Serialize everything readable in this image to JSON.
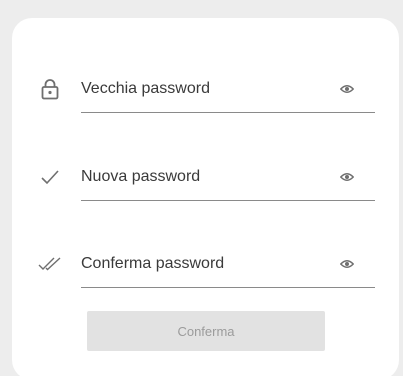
{
  "form": {
    "fields": [
      {
        "label": "Vecchia password",
        "leading_icon": "lock-icon",
        "trailing_icon": "eye-icon"
      },
      {
        "label": "Nuova password",
        "leading_icon": "check-icon",
        "trailing_icon": "eye-icon"
      },
      {
        "label": "Conferma password",
        "leading_icon": "double-check-icon",
        "trailing_icon": "eye-icon"
      }
    ],
    "submit_label": "Conferma"
  },
  "colors": {
    "background": "#ededed",
    "card": "#ffffff",
    "text": "#3a3a3a",
    "icon": "#6f6f6f",
    "button_disabled_bg": "#e2e2e2",
    "button_disabled_text": "#9b9b9b"
  }
}
